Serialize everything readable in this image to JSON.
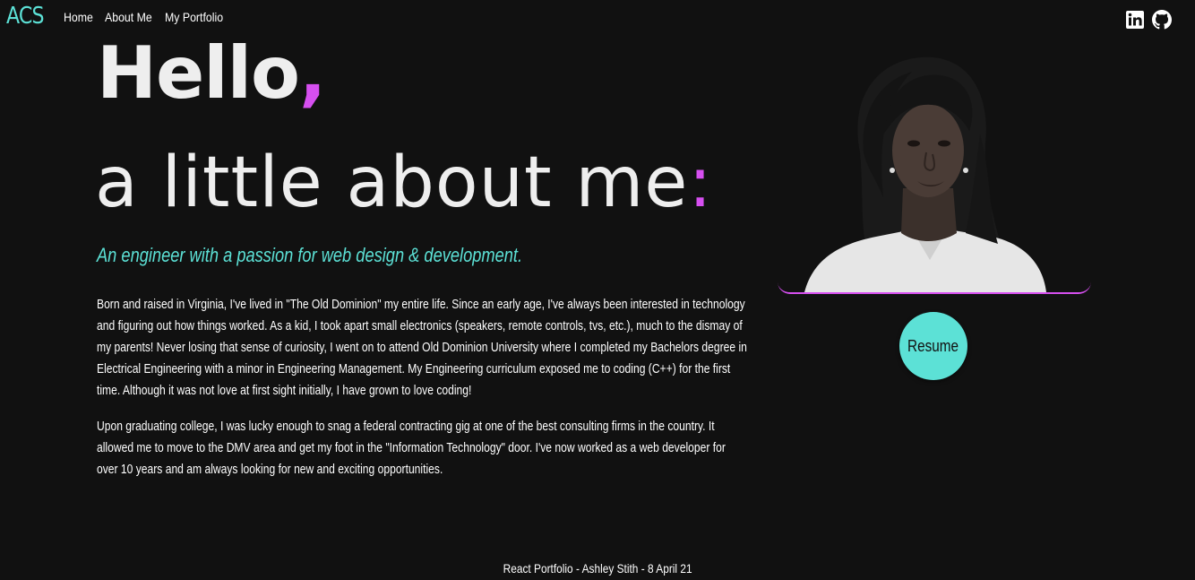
{
  "nav": {
    "brand": "ACS",
    "links": [
      "Home",
      "About Me",
      "My Portfolio"
    ],
    "social": [
      {
        "icon": "linkedin-icon"
      },
      {
        "icon": "github-icon"
      }
    ]
  },
  "hero": {
    "line1": "Hello",
    "line1_punct": ",",
    "line2": "a little about me",
    "line2_punct": ":",
    "tagline": "An engineer with a passion for web design & development."
  },
  "bio": {
    "paragraphs": [
      "Born and raised in Virginia, I've lived in \"The Old Dominion\" my entire life. Since an early age, I've always been interested in technology and figuring out how things worked. As a kid, I took apart small electronics (speakers, remote controls, tvs, etc.), much to the dismay of my parents! Never losing that sense of curiosity, I went on to attend Old Dominion University where I completed my Bachelors degree in Electrical Engineering with a minor in Engineering Management. My Engineering curriculum exposed me to coding (C++) for the first time. Although it was not love at first sight initially, I have grown to love coding!",
      "Upon graduating college, I was lucky enough to snag a federal contracting gig at one of the best consulting firms in the country. It allowed me to move to the DMV area and get my foot in the \"Information Technology\" door. I've now worked as a web developer for over 10 years and am always looking for new and exciting opportunities."
    ]
  },
  "resume": {
    "label": "Resume"
  },
  "footer": {
    "text": "React Portfolio - Ashley Stith - 8 April 21"
  },
  "colors": {
    "accent": "#5ce1d6",
    "highlight": "#d64ff0",
    "background": "#111111"
  }
}
